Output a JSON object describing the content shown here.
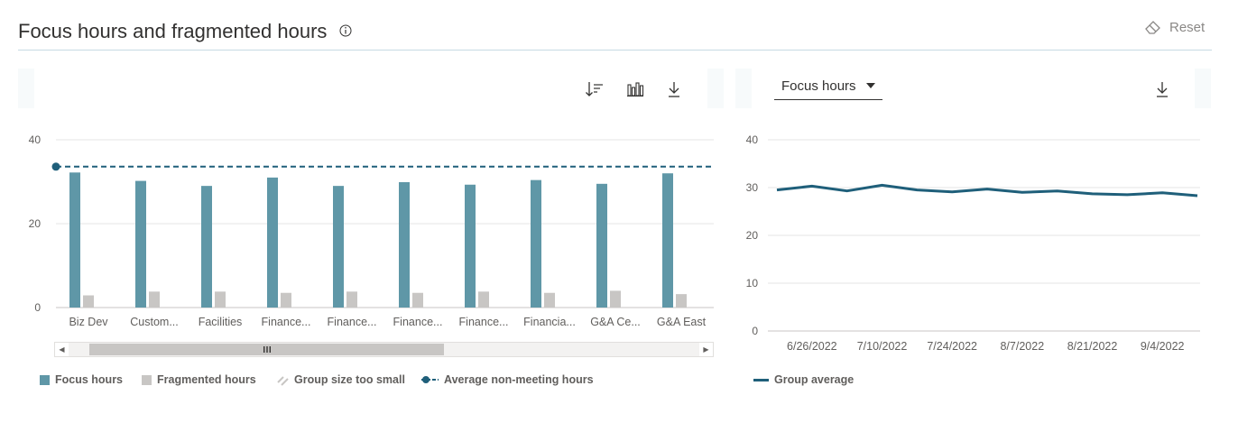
{
  "header": {
    "title": "Focus hours and fragmented hours",
    "reset_label": "Reset"
  },
  "icons": {
    "info": "info-icon",
    "reset": "eraser-icon",
    "sort": "sort-icon",
    "chart_type": "bar-chart-icon",
    "download": "download-icon",
    "dropdown": "caret-down-icon",
    "scroll_grip": "grip-icon"
  },
  "colors": {
    "focus": "#5f97a7",
    "fragmented": "#c8c6c4",
    "average": "#1f5f7a",
    "line": "#1f5f7a",
    "grid": "#e6e6e6"
  },
  "right_panel": {
    "metric_selected": "Focus hours"
  },
  "legend_left": {
    "focus": "Focus hours",
    "fragmented": "Fragmented hours",
    "small": "Group size too small",
    "average": "Average non-meeting hours"
  },
  "legend_right": {
    "group_average": "Group average"
  },
  "chart_data": [
    {
      "type": "bar",
      "categories": [
        "Biz Dev",
        "Custom...",
        "Facilities",
        "Finance...",
        "Finance...",
        "Finance...",
        "Finance...",
        "Financia...",
        "G&A Ce...",
        "G&A East"
      ],
      "series": [
        {
          "name": "Focus hours",
          "values": [
            32.2,
            30.2,
            29.0,
            31.0,
            29.0,
            29.9,
            29.3,
            30.4,
            29.5,
            32.0
          ]
        },
        {
          "name": "Fragmented hours",
          "values": [
            2.9,
            3.8,
            3.8,
            3.5,
            3.8,
            3.5,
            3.8,
            3.5,
            4.0,
            3.2
          ]
        }
      ],
      "reference_line": {
        "name": "Average non-meeting hours",
        "value": 33.6
      },
      "yticks": [
        0,
        20,
        40
      ],
      "ylim": [
        0,
        40
      ],
      "grid": true
    },
    {
      "type": "line",
      "series": [
        {
          "name": "Group average",
          "values": [
            29.5,
            30.3,
            29.3,
            30.5,
            29.5,
            29.1,
            29.7,
            29.0,
            29.3,
            28.7,
            28.5,
            28.9,
            28.3
          ]
        }
      ],
      "x_labels": [
        "6/26/2022",
        "7/10/2022",
        "7/24/2022",
        "8/7/2022",
        "8/21/2022",
        "9/4/2022"
      ],
      "yticks": [
        0,
        10,
        20,
        30,
        40
      ],
      "ylim": [
        0,
        40
      ],
      "grid": true
    }
  ]
}
